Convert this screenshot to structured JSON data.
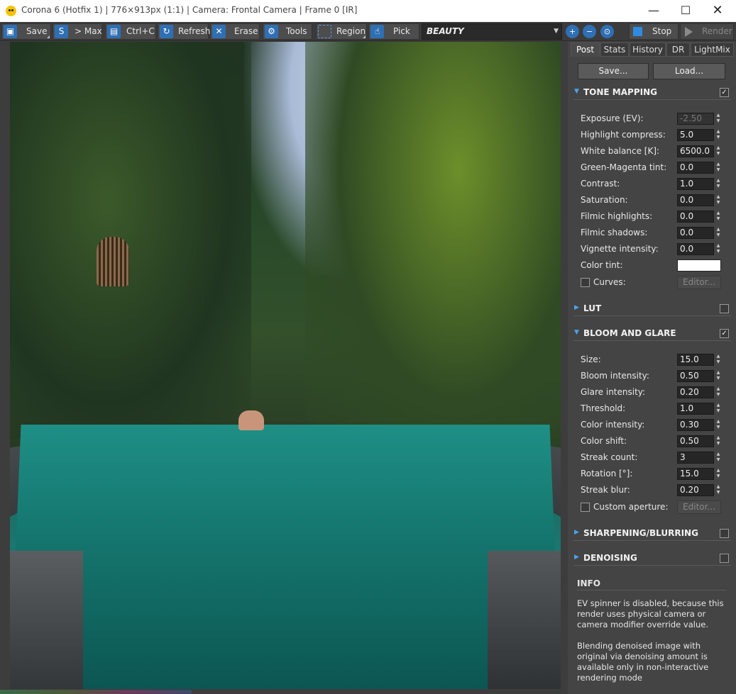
{
  "window": {
    "title": "Corona 6 (Hotfix 1) | 776×913px (1:1) | Camera: Frontal Camera | Frame 0 [IR]",
    "min_glyph": "—",
    "max_glyph": "☐",
    "close_glyph": "✕"
  },
  "toolbar": {
    "save": "Save",
    "to_max": "> Max",
    "copy": "Ctrl+C",
    "refresh": "Refresh",
    "erase": "Erase",
    "tools": "Tools",
    "region": "Region",
    "pick": "Pick",
    "render_pass": "BEAUTY",
    "stop": "Stop",
    "render": "Render"
  },
  "tabs": [
    "Post",
    "Stats",
    "History",
    "DR",
    "LightMix"
  ],
  "panel_buttons": {
    "save": "Save...",
    "load": "Load..."
  },
  "tone_mapping": {
    "title": "TONE MAPPING",
    "enabled": true,
    "rows": [
      {
        "label": "Exposure (EV):",
        "value": "-2.50",
        "disabled": true
      },
      {
        "label": "Highlight compress:",
        "value": "5.0"
      },
      {
        "label": "White balance [K]:",
        "value": "6500.0"
      },
      {
        "label": "Green-Magenta tint:",
        "value": "0.0"
      },
      {
        "label": "Contrast:",
        "value": "1.0"
      },
      {
        "label": "Saturation:",
        "value": "0.0"
      },
      {
        "label": "Filmic highlights:",
        "value": "0.0"
      },
      {
        "label": "Filmic shadows:",
        "value": "0.0"
      },
      {
        "label": "Vignette intensity:",
        "value": "0.0"
      }
    ],
    "color_tint_label": "Color tint:",
    "color_tint_value": "#ffffff",
    "curves_label": "Curves:",
    "curves_editor": "Editor..."
  },
  "lut": {
    "title": "LUT",
    "enabled": false
  },
  "bloom": {
    "title": "BLOOM AND GLARE",
    "enabled": true,
    "rows": [
      {
        "label": "Size:",
        "value": "15.0"
      },
      {
        "label": "Bloom intensity:",
        "value": "0.50"
      },
      {
        "label": "Glare intensity:",
        "value": "0.20"
      },
      {
        "label": "Threshold:",
        "value": "1.0"
      },
      {
        "label": "Color intensity:",
        "value": "0.30"
      },
      {
        "label": "Color shift:",
        "value": "0.50"
      },
      {
        "label": "Streak count:",
        "value": "3"
      },
      {
        "label": "Rotation [°]:",
        "value": "15.0"
      },
      {
        "label": "Streak blur:",
        "value": "0.20"
      }
    ],
    "aperture_label": "Custom aperture:",
    "aperture_editor": "Editor..."
  },
  "sharpening": {
    "title": "SHARPENING/BLURRING",
    "enabled": false
  },
  "denoising": {
    "title": "DENOISING",
    "enabled": false
  },
  "info": {
    "title": "INFO",
    "line1": "EV spinner is disabled, because this render uses physical camera or camera modifier override value.",
    "line2": "Blending denoised image with original via denoising amount is available only in non-interactive rendering mode"
  },
  "colors": {
    "accent": "#2f6fb3",
    "panel_bg": "#444444",
    "section_arrow": "#4aa3f0"
  }
}
